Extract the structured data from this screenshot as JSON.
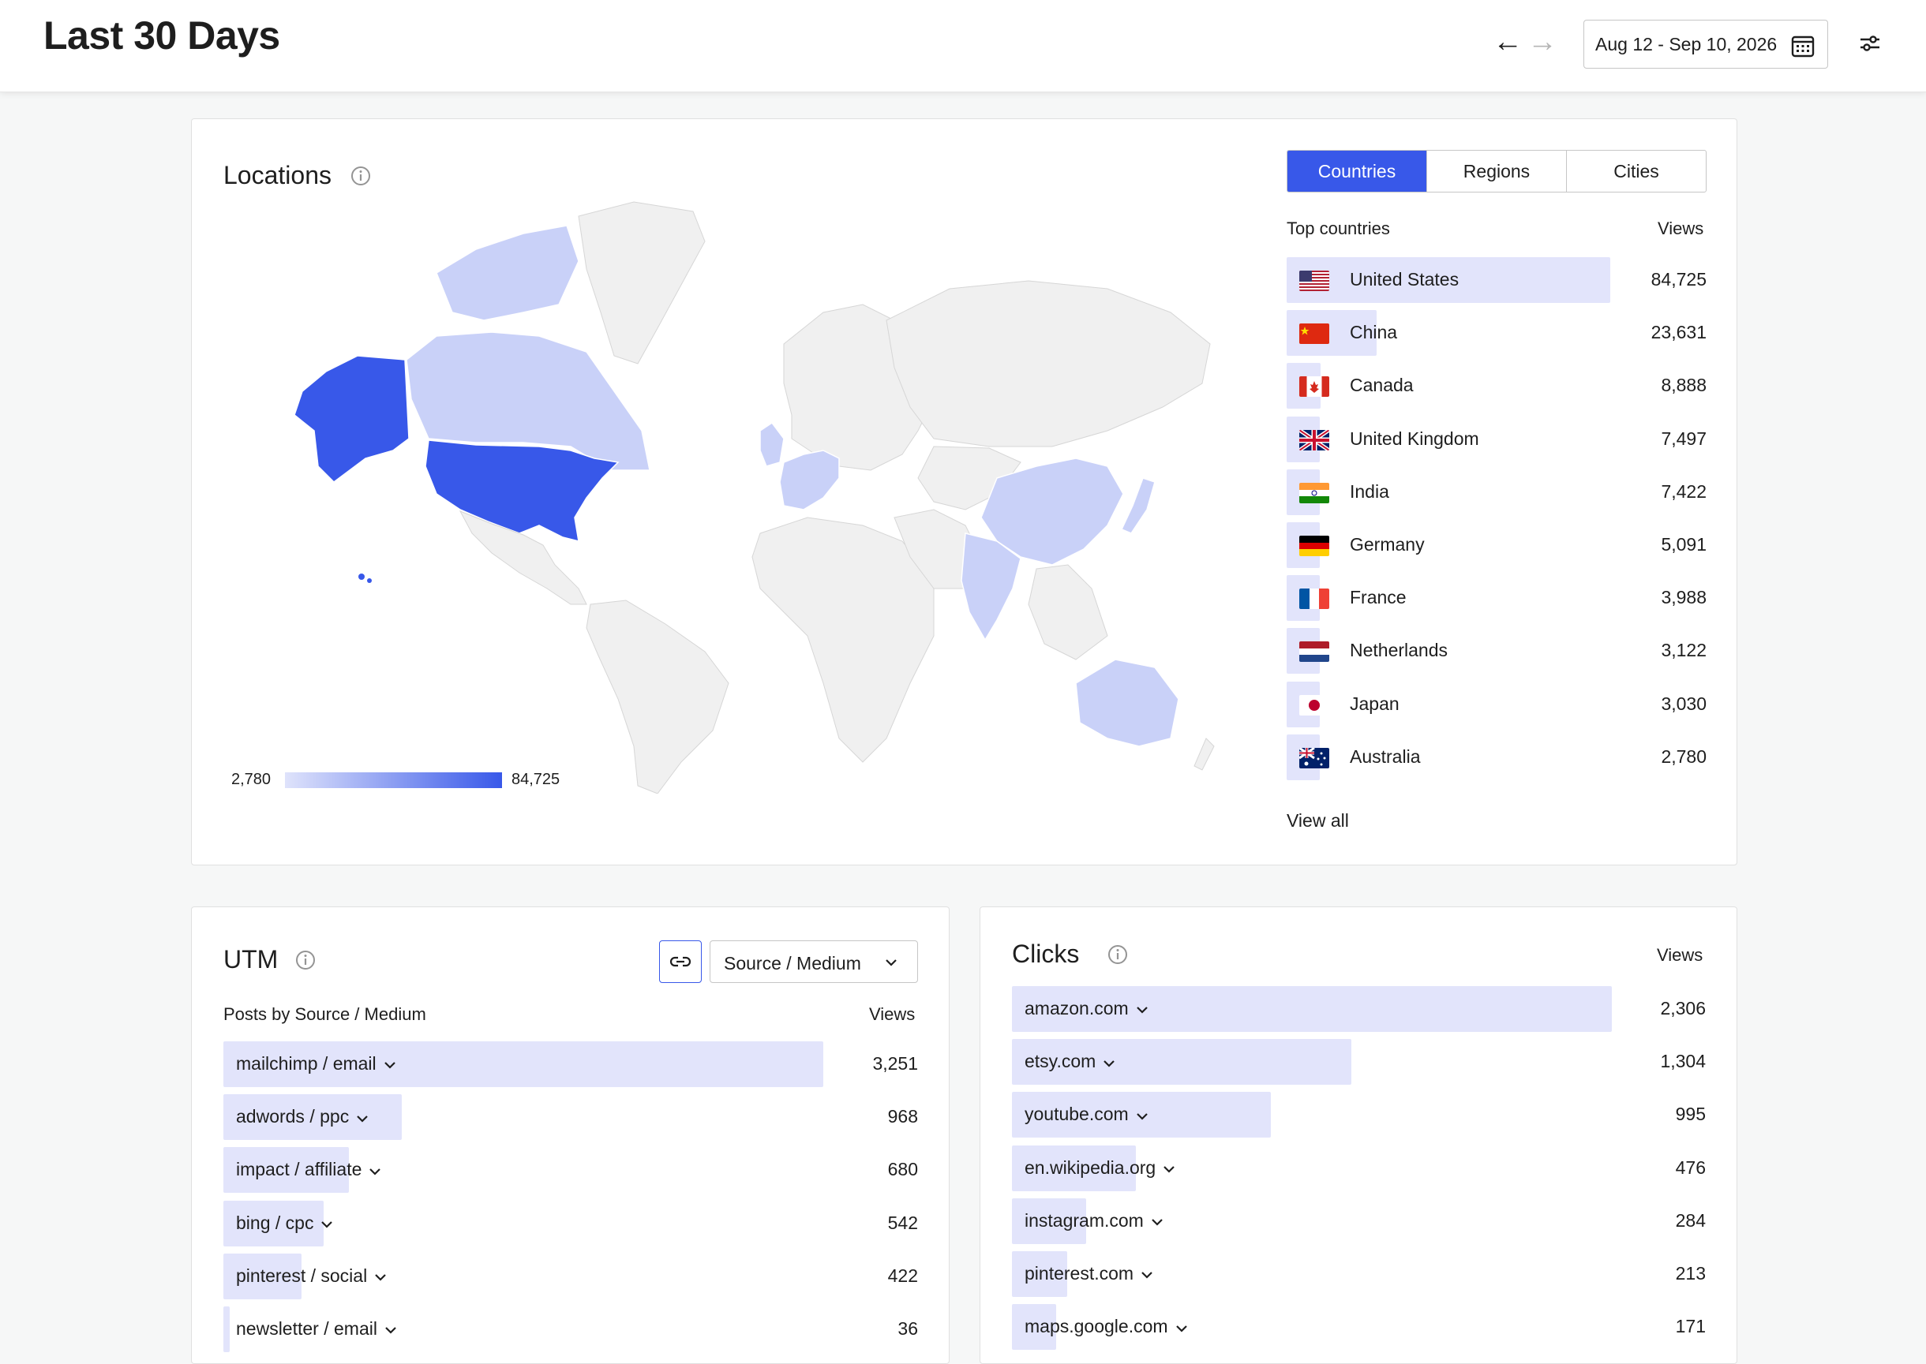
{
  "header": {
    "title": "Last 30 Days",
    "prev_icon": "arrow-left-icon",
    "next_icon": "arrow-right-icon",
    "date_range": "Aug 12 - Sep 10, 2026",
    "calendar_icon": "calendar-icon",
    "filter_icon": "sliders-icon"
  },
  "locations": {
    "title": "Locations",
    "tabs": [
      {
        "label": "Countries",
        "active": true
      },
      {
        "label": "Regions",
        "active": false
      },
      {
        "label": "Cities",
        "active": false
      }
    ],
    "list_header": "Top countries",
    "value_header": "Views",
    "countries": [
      {
        "name": "United States",
        "views": "84,725",
        "value": 84725,
        "flag": "us"
      },
      {
        "name": "China",
        "views": "23,631",
        "value": 23631,
        "flag": "cn"
      },
      {
        "name": "Canada",
        "views": "8,888",
        "value": 8888,
        "flag": "ca"
      },
      {
        "name": "United Kingdom",
        "views": "7,497",
        "value": 7497,
        "flag": "gb"
      },
      {
        "name": "India",
        "views": "7,422",
        "value": 7422,
        "flag": "in"
      },
      {
        "name": "Germany",
        "views": "5,091",
        "value": 5091,
        "flag": "de"
      },
      {
        "name": "France",
        "views": "3,988",
        "value": 3988,
        "flag": "fr"
      },
      {
        "name": "Netherlands",
        "views": "3,122",
        "value": 3122,
        "flag": "nl"
      },
      {
        "name": "Japan",
        "views": "3,030",
        "value": 3030,
        "flag": "jp"
      },
      {
        "name": "Australia",
        "views": "2,780",
        "value": 2780,
        "flag": "au"
      }
    ],
    "view_all": "View all",
    "legend_min": "2,780",
    "legend_max": "84,725",
    "colors": {
      "accent": "#3858e9",
      "bar": "#e2e4fb",
      "map_light": "#c9d1f8",
      "land": "#f0f0f0"
    }
  },
  "utm": {
    "title": "UTM",
    "link_icon": "link-icon",
    "select_value": "Source / Medium",
    "list_header": "Posts by Source / Medium",
    "value_header": "Views",
    "rows": [
      {
        "label": "mailchimp / email",
        "views": "3,251",
        "value": 3251
      },
      {
        "label": "adwords / ppc",
        "views": "968",
        "value": 968
      },
      {
        "label": "impact / affiliate",
        "views": "680",
        "value": 680
      },
      {
        "label": "bing / cpc",
        "views": "542",
        "value": 542
      },
      {
        "label": "pinterest / social",
        "views": "422",
        "value": 422
      },
      {
        "label": "newsletter / email",
        "views": "36",
        "value": 36
      }
    ]
  },
  "clicks": {
    "title": "Clicks",
    "value_header": "Views",
    "rows": [
      {
        "label": "amazon.com",
        "views": "2,306",
        "value": 2306
      },
      {
        "label": "etsy.com",
        "views": "1,304",
        "value": 1304
      },
      {
        "label": "youtube.com",
        "views": "995",
        "value": 995
      },
      {
        "label": "en.wikipedia.org",
        "views": "476",
        "value": 476
      },
      {
        "label": "instagram.com",
        "views": "284",
        "value": 284
      },
      {
        "label": "pinterest.com",
        "views": "213",
        "value": 213
      },
      {
        "label": "maps.google.com",
        "views": "171",
        "value": 171
      }
    ]
  }
}
